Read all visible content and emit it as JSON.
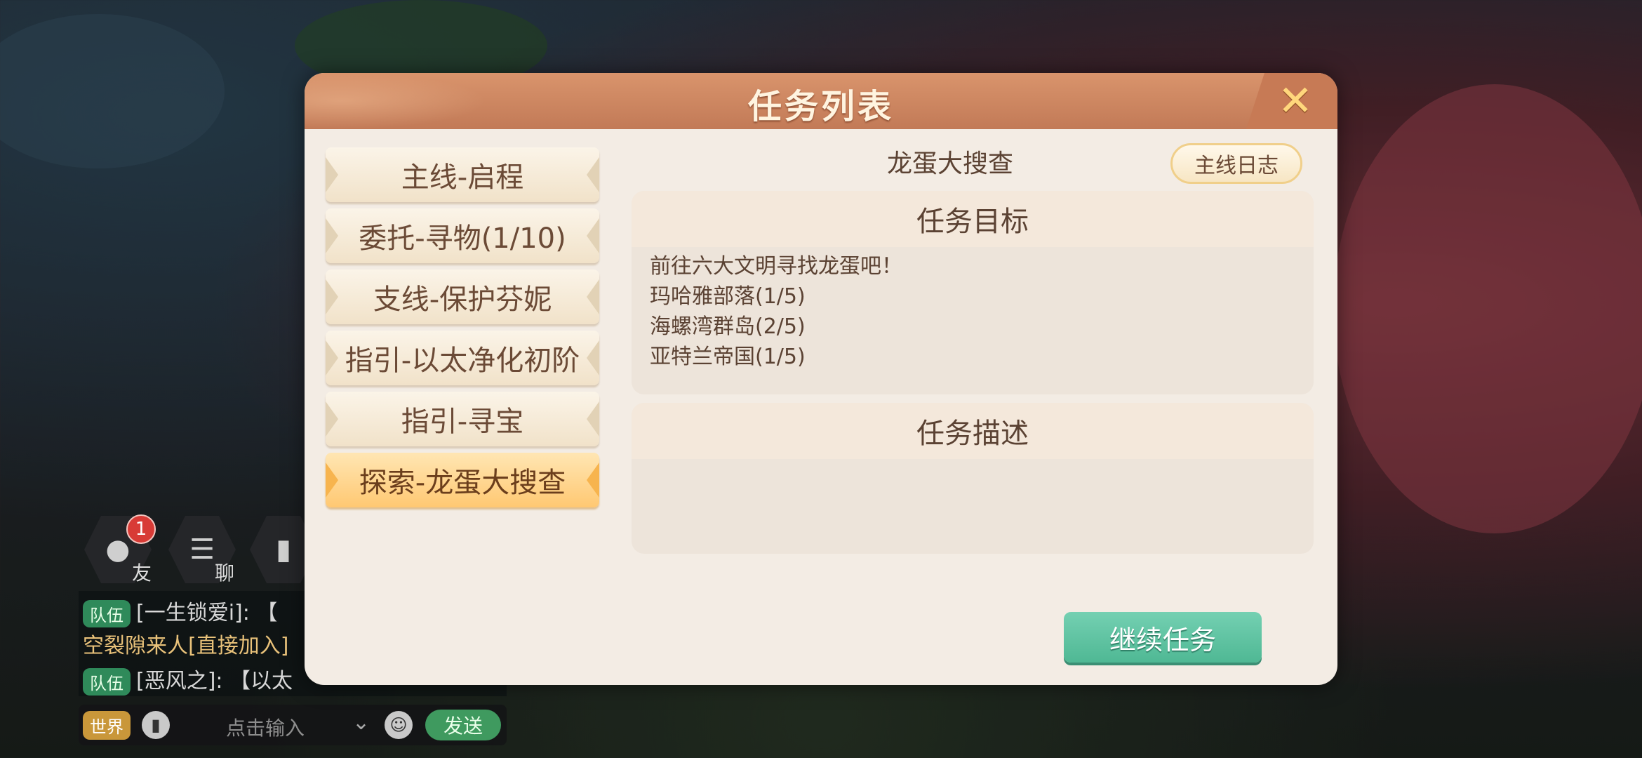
{
  "dialog": {
    "title": "任务列表",
    "close_icon": "close-icon"
  },
  "tabs": [
    {
      "label": "主线-启程",
      "active": false
    },
    {
      "label": "委托-寻物(1/10)",
      "active": false
    },
    {
      "label": "支线-保护芬妮",
      "active": false
    },
    {
      "label": "指引-以太净化初阶",
      "active": false
    },
    {
      "label": "指引-寻宝",
      "active": false
    },
    {
      "label": "探索-龙蛋大搜查",
      "active": true
    }
  ],
  "quest": {
    "name": "龙蛋大搜查",
    "log_button": "主线日志",
    "goal_header": "任务目标",
    "goals": [
      "前往六大文明寻找龙蛋吧！",
      "玛哈雅部落(1/5)",
      "海螺湾群岛(2/5)",
      "亚特兰帝国(1/5)"
    ],
    "desc_header": "任务描述",
    "continue_button": "继续任务"
  },
  "hud": {
    "friend_label": "友",
    "chat_label": "聊",
    "friend_badge": "1",
    "chat_lines": [
      {
        "tag": "队伍",
        "text": "[一生锁爱i]: 【"
      },
      {
        "tag": "",
        "text": "空裂隙来人[直接加入]"
      },
      {
        "tag": "队伍",
        "text": "[恶风之]: 【以太"
      }
    ],
    "world_tag": "世界",
    "input_placeholder": "点击输入",
    "send_label": "发送"
  }
}
